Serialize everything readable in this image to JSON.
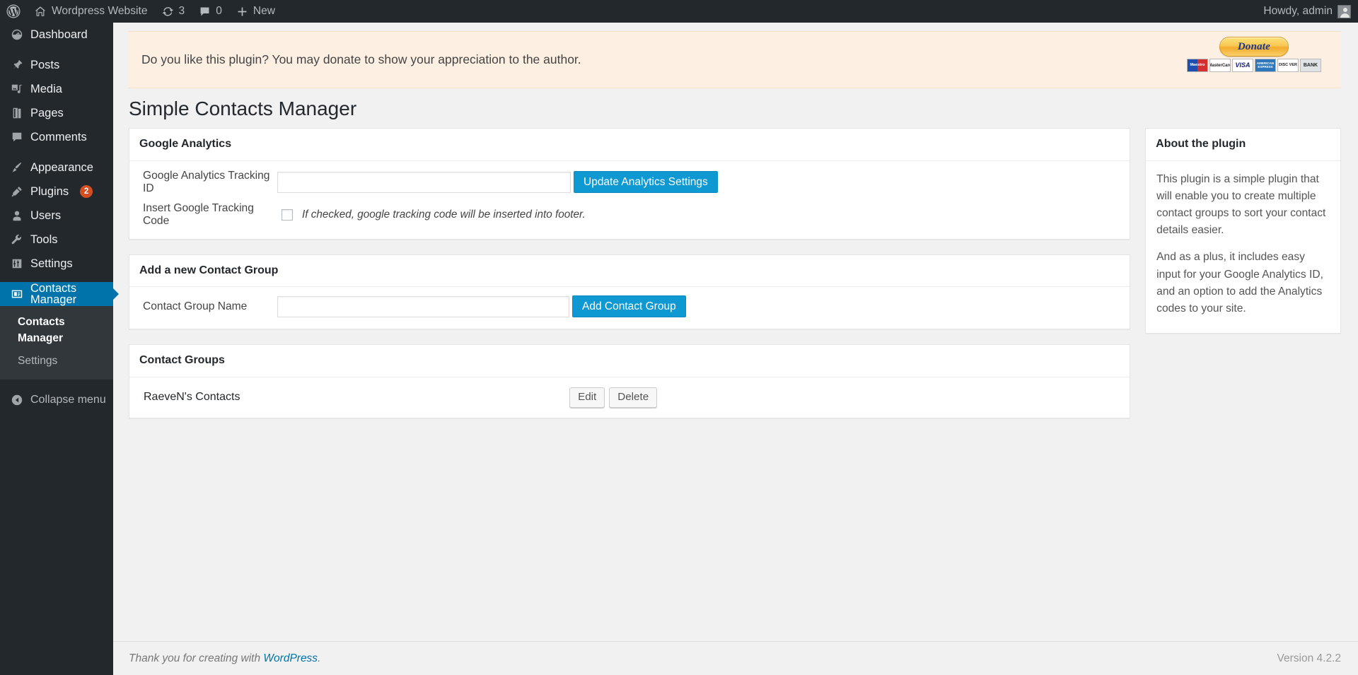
{
  "adminbar": {
    "logo_icon": "wordpress-logo-icon",
    "site_name": "Wordpress Website",
    "site_icon": "home-icon",
    "updates_icon": "updates-icon",
    "updates_count": "3",
    "comments_icon": "comment-bubble-icon",
    "comments_count": "0",
    "new_icon": "plus-icon",
    "new_label": "New",
    "howdy": "Howdy, admin",
    "avatar": "user-avatar-icon"
  },
  "sidebar": {
    "items": [
      {
        "label": "Dashboard",
        "icon": "dashboard-icon",
        "current": false,
        "badge": null
      },
      {
        "label": "Posts",
        "icon": "posts-pin-icon",
        "current": false,
        "badge": null
      },
      {
        "label": "Media",
        "icon": "media-icon",
        "current": false,
        "badge": null
      },
      {
        "label": "Pages",
        "icon": "pages-icon",
        "current": false,
        "badge": null
      },
      {
        "label": "Comments",
        "icon": "comments-icon",
        "current": false,
        "badge": null
      },
      {
        "label": "Appearance",
        "icon": "appearance-brush-icon",
        "current": false,
        "badge": null
      },
      {
        "label": "Plugins",
        "icon": "plugins-plug-icon",
        "current": false,
        "badge": "2"
      },
      {
        "label": "Users",
        "icon": "users-icon",
        "current": false,
        "badge": null
      },
      {
        "label": "Tools",
        "icon": "tools-wrench-icon",
        "current": false,
        "badge": null
      },
      {
        "label": "Settings",
        "icon": "settings-sliders-icon",
        "current": false,
        "badge": null
      },
      {
        "label": "Contacts Manager",
        "icon": "contacts-card-icon",
        "current": true,
        "badge": null
      }
    ],
    "submenu": [
      {
        "label": "Contacts Manager",
        "current": true
      },
      {
        "label": "Settings",
        "current": false
      }
    ],
    "collapse_label": "Collapse menu",
    "collapse_icon": "collapse-arrow-icon",
    "accent_color": "#0073aa",
    "background_color": "#23282d",
    "badge_color": "#d54e21"
  },
  "notice": {
    "text": "Do you like this plugin? You may donate to show your appreciation to the author.",
    "background_color": "#fdf0e3",
    "donate_label": "Donate",
    "cards": [
      {
        "name": "maestro-card-icon",
        "label": "Maestro"
      },
      {
        "name": "mastercard-card-icon",
        "label": "MasterCard"
      },
      {
        "name": "visa-card-icon",
        "label": "VISA"
      },
      {
        "name": "amex-card-icon",
        "label": "AMERICAN EXPRESS"
      },
      {
        "name": "discover-card-icon",
        "label": "DISC VER"
      },
      {
        "name": "bank-card-icon",
        "label": "BANK"
      }
    ]
  },
  "page": {
    "title": "Simple Contacts Manager"
  },
  "google_analytics": {
    "heading": "Google Analytics",
    "tracking_id_label": "Google Analytics Tracking ID",
    "tracking_id_value": "",
    "tracking_id_placeholder": "",
    "update_button": "Update Analytics Settings",
    "insert_code_label": "Insert Google Tracking Code",
    "insert_code_checked": false,
    "insert_code_note": "If checked, google tracking code will be inserted into footer."
  },
  "add_group": {
    "heading": "Add a new Contact Group",
    "name_label": "Contact Group Name",
    "name_value": "",
    "name_placeholder": "",
    "add_button": "Add Contact Group"
  },
  "contact_groups": {
    "heading": "Contact Groups",
    "edit_label": "Edit",
    "delete_label": "Delete",
    "rows": [
      {
        "name": "RaeveN's Contacts"
      }
    ]
  },
  "about": {
    "heading": "About the plugin",
    "paragraph1": "This plugin is a simple plugin that will enable you to create multiple contact groups to sort your contact details easier.",
    "paragraph2": "And as a plus, it includes easy input for your Google Analytics ID, and an option to add the Analytics codes to your site."
  },
  "footer": {
    "thanks_prefix": "Thank you for creating with ",
    "wordpress_link": "WordPress",
    "thanks_suffix": ".",
    "version": "Version 4.2.2"
  }
}
